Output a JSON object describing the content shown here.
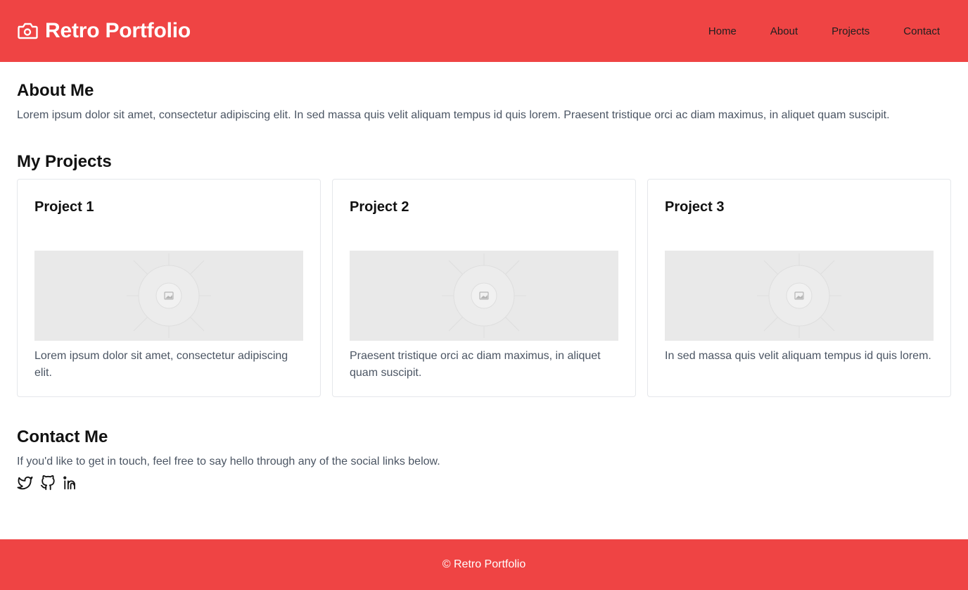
{
  "colors": {
    "accent": "#ef4444",
    "text": "#111111",
    "muted": "#4b5563",
    "placeholder": "#e9e9e9"
  },
  "header": {
    "logo_icon": "camera-icon",
    "title": "Retro Portfolio",
    "nav": [
      {
        "label": "Home"
      },
      {
        "label": "About"
      },
      {
        "label": "Projects"
      },
      {
        "label": "Contact"
      }
    ]
  },
  "about": {
    "title": "About Me",
    "text": "Lorem ipsum dolor sit amet, consectetur adipiscing elit. In sed massa quis velit aliquam tempus id quis lorem. Praesent tristique orci ac diam maximus, in aliquet quam suscipit."
  },
  "projects": {
    "title": "My Projects",
    "items": [
      {
        "title": "Project 1",
        "description": "Lorem ipsum dolor sit amet, consectetur adipiscing elit."
      },
      {
        "title": "Project 2",
        "description": "Praesent tristique orci ac diam maximus, in aliquet quam suscipit."
      },
      {
        "title": "Project 3",
        "description": "In sed massa quis velit aliquam tempus id quis lorem."
      }
    ]
  },
  "contact": {
    "title": "Contact Me",
    "text": "If you'd like to get in touch, feel free to say hello through any of the social links below.",
    "socials": [
      "twitter-icon",
      "github-icon",
      "linkedin-icon"
    ]
  },
  "footer": {
    "text": "© Retro Portfolio"
  }
}
